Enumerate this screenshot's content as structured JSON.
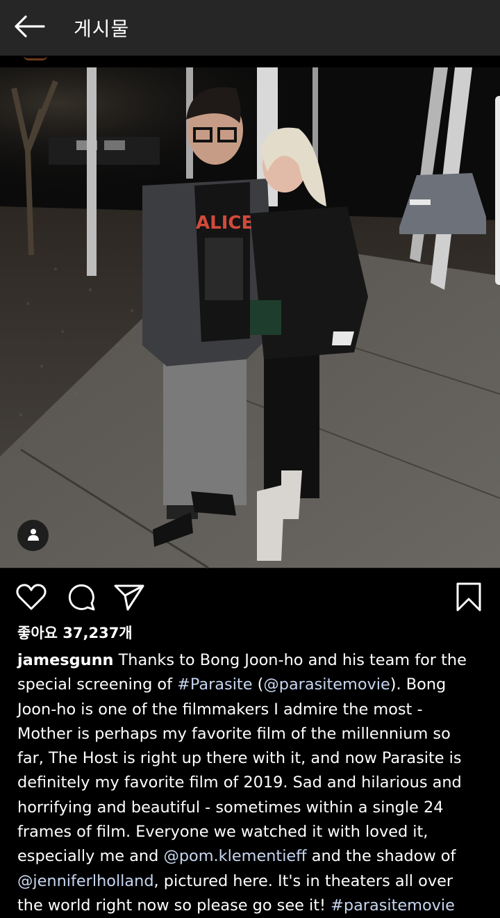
{
  "header": {
    "title": "게시물",
    "back_icon": "arrow-left-icon"
  },
  "post": {
    "image_alt": "photo",
    "user_tag_icon": "person-icon",
    "actions": {
      "like_icon": "heart-icon",
      "comment_icon": "comment-icon",
      "share_icon": "send-icon",
      "save_icon": "bookmark-icon"
    },
    "likes_text": "좋아요 37,237개",
    "caption": {
      "username": "jamesgunn",
      "l1": " Thanks to Bong Joon-ho and his team for the",
      "l2a": "special screening of ",
      "l2_tag": "#Parasite",
      "l2b": " (",
      "l2_mention": "@parasitemovie",
      "l2c": "). Bong",
      "l3": "Joon-ho is one of the filmmakers I admire the most -",
      "l4": "Mother is perhaps my favorite film of the millennium so",
      "l5": "far, The Host is right up there with it, and now Parasite is",
      "l6": "definitely my favorite film of 2019. Sad and hilarious and",
      "l7": "horrifying and beautiful - sometimes within a single 24",
      "l8": "frames of film. Everyone we watched it with loved it,",
      "l9a": "especially me and ",
      "l9_mention": "@pom.klementieff",
      "l9b": " and the shadow of",
      "l10_mention": "@jenniferlholland",
      "l10b": ", pictured here. It's in theaters all over",
      "l11a": "the world right now so please go see it! ",
      "l11_tag": "#parasitemovie"
    },
    "shirt_text": "ALICE"
  },
  "colors": {
    "appbar": "#262626",
    "background": "#000000",
    "link": "#c7d6f0"
  }
}
